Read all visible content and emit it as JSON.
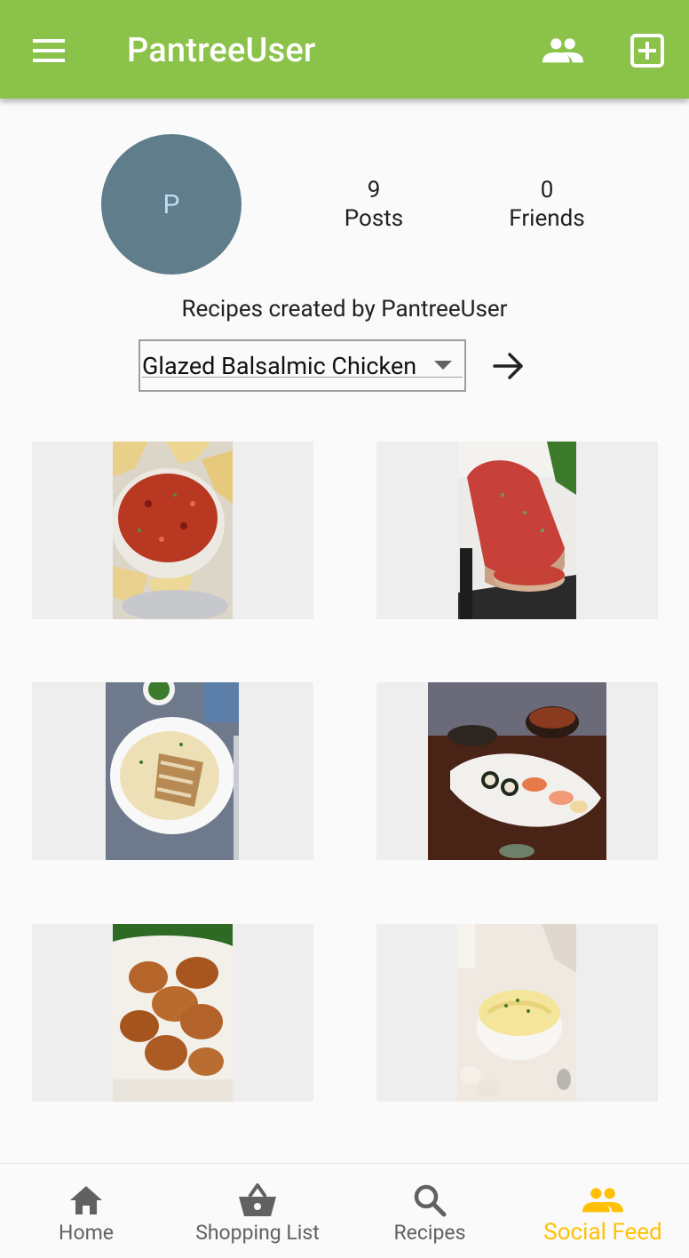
{
  "app_bar": {
    "title": "PantreeUser",
    "menu_icon": "menu-icon",
    "friends_icon": "people-icon",
    "add_icon": "add-box-icon",
    "background": "#8bc34a"
  },
  "profile": {
    "avatar_letter": "P",
    "posts_count": "9",
    "posts_label": "Posts",
    "friends_count": "0",
    "friends_label": "Friends"
  },
  "recipes_section": {
    "heading": "Recipes created by PantreeUser",
    "selected_recipe": "Glazed Balsalmic Chicken",
    "go_icon": "arrow-forward-icon"
  },
  "posts": [
    {
      "image": "salsa-bowl"
    },
    {
      "image": "meatloaf"
    },
    {
      "image": "chicken-fettuccine-alfredo"
    },
    {
      "image": "sushi-plate"
    },
    {
      "image": "fried-chicken"
    },
    {
      "image": "mashed-potatoes"
    }
  ],
  "bottom_nav": {
    "items": [
      {
        "label": "Home",
        "icon": "home-icon",
        "active": false
      },
      {
        "label": "Shopping List",
        "icon": "basket-icon",
        "active": false
      },
      {
        "label": "Recipes",
        "icon": "search-icon",
        "active": false
      },
      {
        "label": "Social Feed",
        "icon": "people-icon",
        "active": true
      }
    ],
    "active_color": "#ffc107",
    "inactive_color": "#616161"
  }
}
